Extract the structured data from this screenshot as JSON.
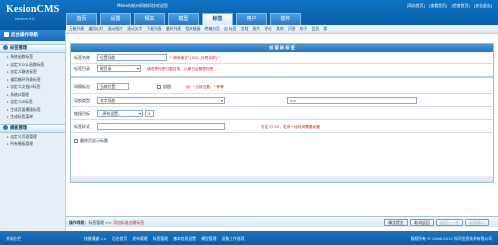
{
  "app": {
    "logo": "KesionCMS",
    "version": "version 9.0",
    "site_info": "Mbee向杭州网络科技欢迎您",
    "header_links": [
      "[网站首页]",
      "[查看首页]",
      "[检查首页]",
      "[安全退出]"
    ]
  },
  "tabs": [
    "首页",
    "设置",
    "相关",
    "模型",
    "标签",
    "用户",
    "插件"
  ],
  "sidebar": {
    "title": "后台操作导航",
    "groups": [
      {
        "label": "标签管理",
        "items": [
          "系统函数标签",
          "自定义SQL函数标签",
          "自定义静态标签",
          "通用循环列表标签",
          "自定义文档JS标签",
          "系统JS管理",
          "自定义JS标签",
          "生成页面模版标签",
          "生成标签菜单"
        ]
      },
      {
        "label": "模板管理",
        "items": [
          "自定义页面管理",
          "所有模板管理"
        ]
      }
    ]
  },
  "subnav": [
    "万能列表",
    "通用幻灯",
    "滚动图片",
    "滚动文字",
    "下载列表",
    "循环列表",
    "相关链接",
    "终端分页",
    "自 标签",
    "文档",
    "图片",
    "评论",
    "其他",
    "问答",
    "帖子",
    "会员",
    "我 "
  ],
  "form": {
    "panel_title": "创 建 新 标 签",
    "tag_name": {
      "label": "标签名称",
      "value": "位置导航",
      "hint": "* 调用格式\"{SQL_标签名称}\""
    },
    "tag_dir": {
      "label": "标签目录",
      "value": "根目录",
      "hint": "请选择标签归属目录，以便日后管理标签"
    },
    "separator": {
      "label": "间隔标志",
      "value": "当前位置：",
      "checkbox": "加粗",
      "hint": "如：\"当前位置：\" 等等"
    },
    "nav_type": {
      "label": "导航类型",
      "value": "文字导航",
      "extra": ">>"
    },
    "link_target": {
      "label": "链接目标",
      "value": "--原有设置--",
      "extra": "5"
    },
    "tag_style": {
      "label": "标签样式",
      "hint": "可定义CSS，若有一段时间需要设置"
    },
    "show_home": {
      "label": "最终页显示标题"
    }
  },
  "actionbar": {
    "location_prefix": "操作导航：",
    "path": "标签管理 >> ",
    "current": "添加标准创建标签",
    "buttons": [
      "确定提交",
      "取消返回",
      "返回上一步",
      "标签插入"
    ]
  },
  "footer": {
    "left": "关闭左栏",
    "links": [
      "快捷通道 >>",
      "后台首页",
      "发布管理",
      "标签管理",
      "基本信息设置",
      "模型管理",
      "设备工作选项"
    ],
    "right": "版权所有 © 2006-2012 科汛信息技术有限公司"
  }
}
